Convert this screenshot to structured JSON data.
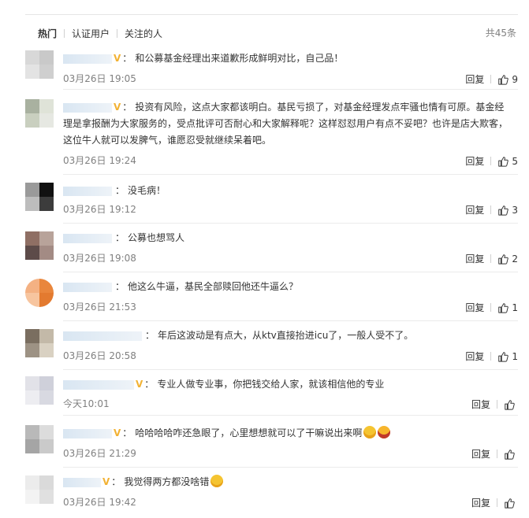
{
  "tabs": [
    {
      "label": "热门"
    },
    {
      "label": "认证用户"
    },
    {
      "label": "关注的人"
    }
  ],
  "total": "共45条",
  "reply_label": "回复",
  "colors": {
    "verified": "#f2b234",
    "divider": "#ebebeb",
    "meta": "#808080"
  },
  "comments": [
    {
      "badge": "V",
      "text": "和公募基金经理出来道歉形成鲜明对比，自己品！",
      "time": "03月26日 19:05",
      "likes": "9",
      "avatar": [
        "#d8d8d8",
        "#c9c9c9",
        "#e3e3e3",
        "#cfcfcf"
      ]
    },
    {
      "badge": "V",
      "text": "投资有风险，这点大家都该明白。基民亏损了，对基金经理发点牢骚也情有可原。基金经理是拿报酬为大家服务的，受点批评可否耐心和大家解释呢？这样怼怼用户有点不妥吧？也许是店大欺客，这位牛人就可以发脾气，谁愿忍受就继续呆着吧。",
      "time": "03月26日 19:24",
      "likes": "5",
      "avatar": [
        "#a9b1a0",
        "#dfe3d8",
        "#c9cfbf",
        "#e6e8e2"
      ]
    },
    {
      "badge": "",
      "text": "没毛病！",
      "time": "03月26日 19:12",
      "likes": "3",
      "avatar": [
        "#9a9a9a",
        "#111111",
        "#bdbdbd",
        "#3c3c3c"
      ]
    },
    {
      "badge": "",
      "text": "公募也想骂人",
      "time": "03月26日 19:08",
      "likes": "2",
      "avatar": [
        "#8f6f64",
        "#b8a39a",
        "#5d4b49",
        "#a38b84"
      ]
    },
    {
      "badge": "",
      "text": "他这么牛逼，基民全部赎回他还牛逼么？",
      "time": "03月26日 21:53",
      "likes": "1",
      "avatar": [
        "#f4b183",
        "#e9863c",
        "#f7c59f",
        "#e37a2f"
      ]
    },
    {
      "badge": "",
      "text": "年后这波动是有点大，从ktv直接抬进icu了，一般人受不了。",
      "time": "03月26日 20:58",
      "likes": "1",
      "avatar": [
        "#7a6e60",
        "#c3b9a8",
        "#9d9284",
        "#d9d1c2"
      ]
    },
    {
      "badge": "V",
      "text": "专业人做专业事，你把钱交给人家，就该相信他的专业",
      "time": "今天10:01",
      "likes": "",
      "avatar": [
        "#e2e2e8",
        "#cfd0da",
        "#ededf1",
        "#d8d9e1"
      ]
    },
    {
      "badge": "V",
      "text": "哈哈哈哈咋还急眼了，心里想想就可以了干嘛说出来啊",
      "time": "03月26日 21:29",
      "likes": "",
      "avatar": [
        "#b9b9b9",
        "#dcdcdc",
        "#a5a5a5",
        "#cacaca"
      ]
    },
    {
      "badge": "V",
      "text": "我觉得两方都没啥错",
      "time": "03月26日 19:42",
      "likes": "",
      "avatar": [
        "#ececec",
        "#dadada",
        "#f3f3f3",
        "#e0e0e0"
      ]
    }
  ]
}
